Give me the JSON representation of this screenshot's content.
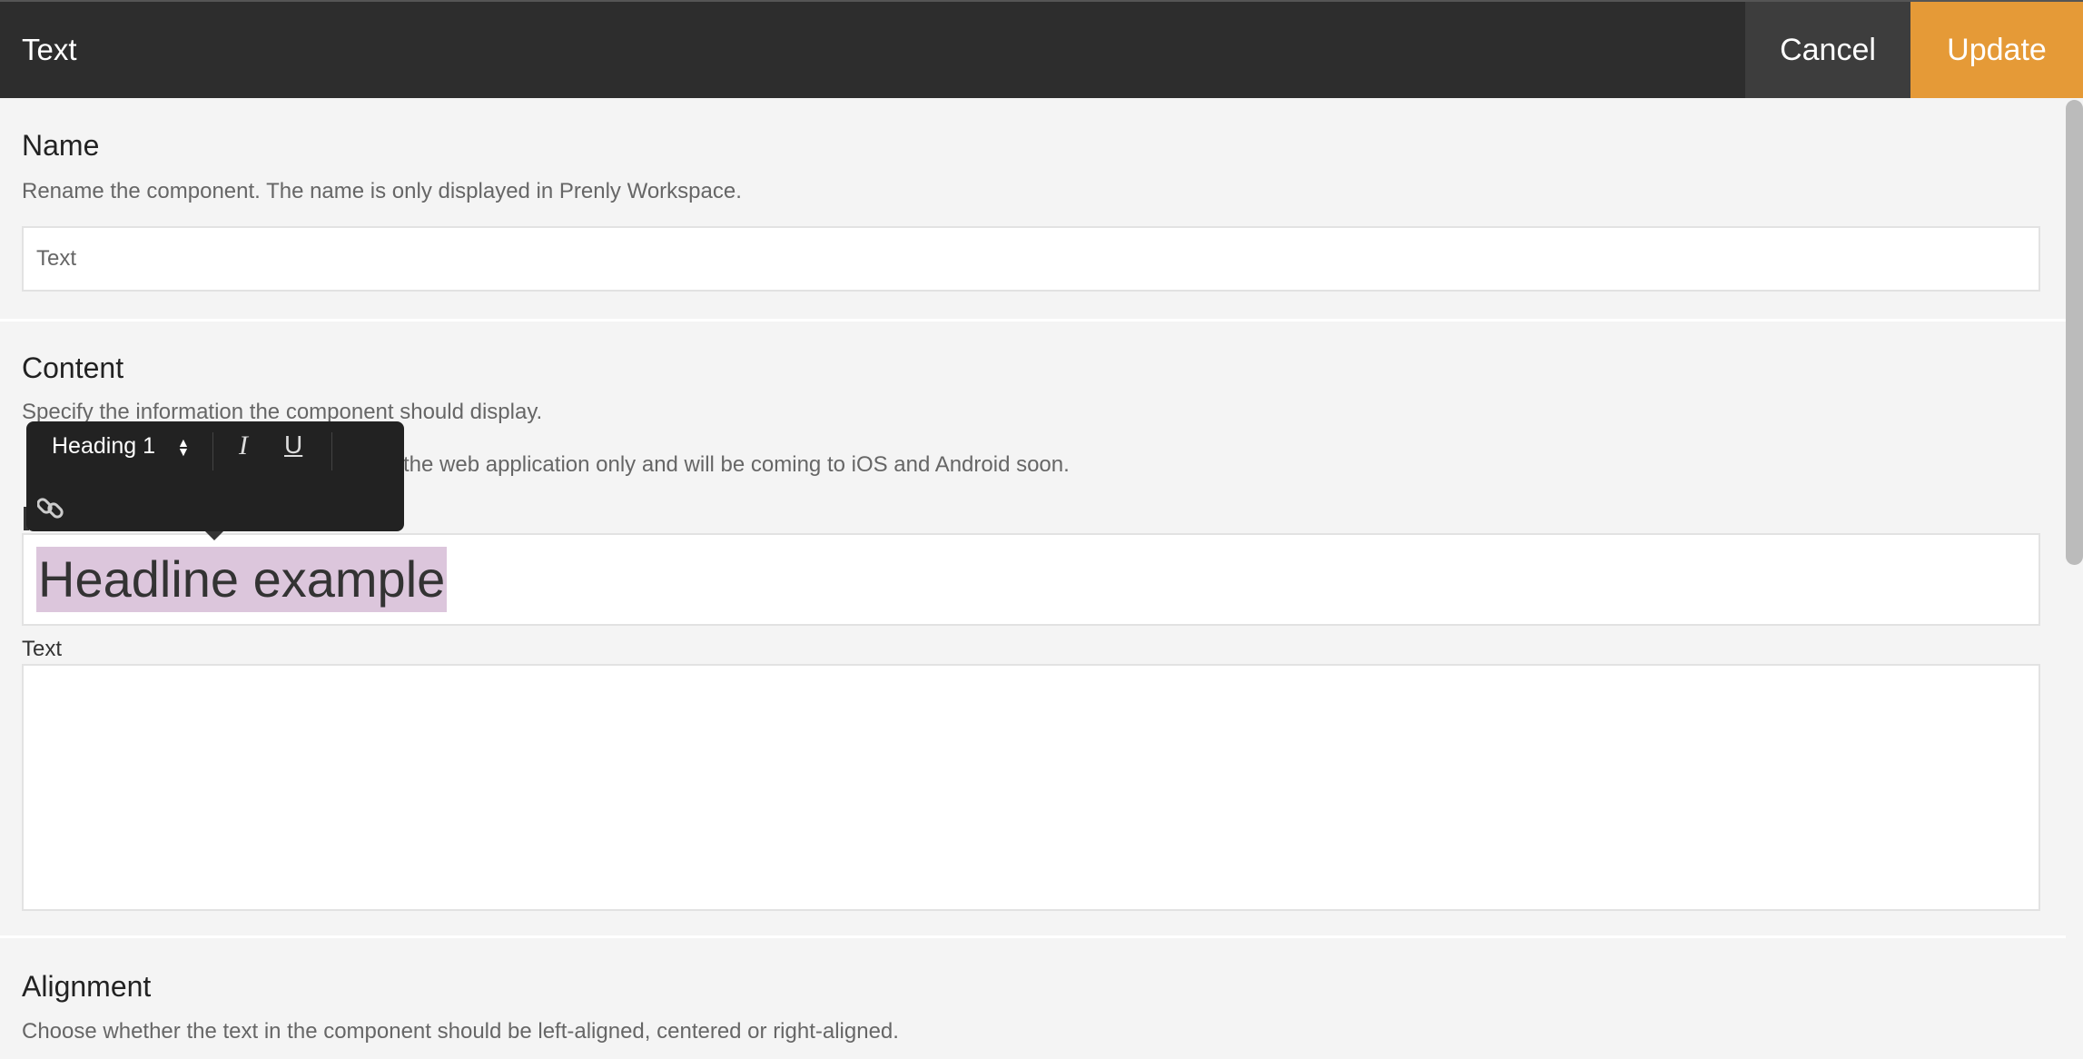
{
  "header": {
    "title": "Text",
    "cancel_label": "Cancel",
    "update_label": "Update"
  },
  "colors": {
    "accent": "#e59a37",
    "header": "#2d2d2d",
    "selection": "#dcc6dc"
  },
  "name_section": {
    "title": "Name",
    "description": "Rename the component. The name is only displayed in Prenly Workspace.",
    "input_value": "Text"
  },
  "content_section": {
    "title": "Content",
    "description": "Specify the information the component should display.",
    "note_partial": "the web application only and will be coming to iOS and Android soon.",
    "headline_value": "Headline example",
    "text_label": "Text",
    "text_value": ""
  },
  "toolbar": {
    "style_select": "Heading 1",
    "icons": [
      "select-arrows-icon",
      "italic-icon",
      "underline-icon",
      "link-icon"
    ],
    "italic_glyph": "I",
    "underline_glyph": "U"
  },
  "alignment_section": {
    "title": "Alignment",
    "description": "Choose whether the text in the component should be left-aligned, centered or right-aligned."
  }
}
